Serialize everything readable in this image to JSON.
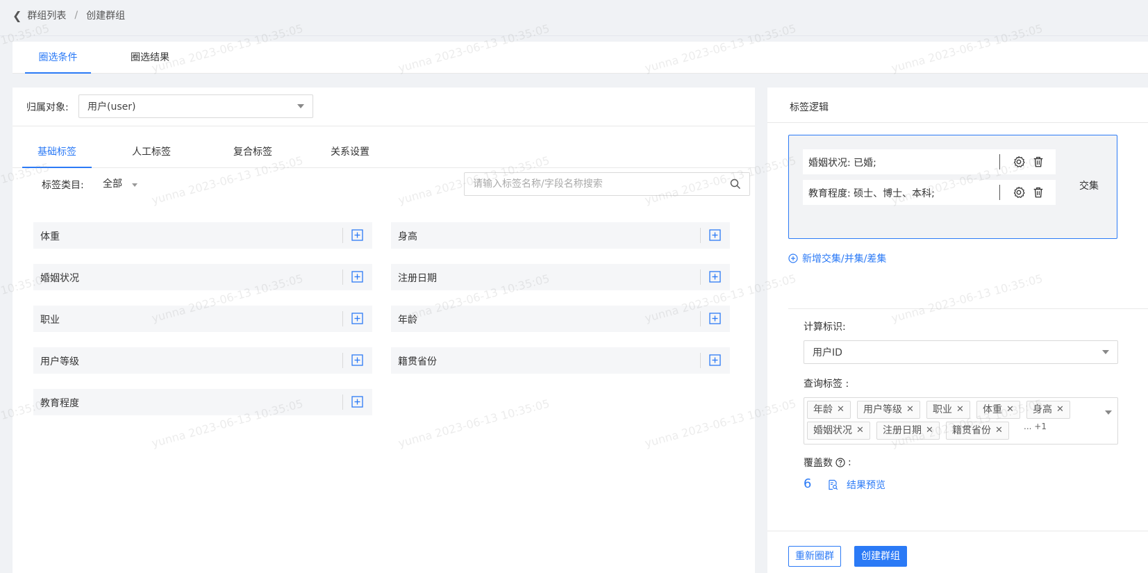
{
  "breadcrumb": {
    "parent": "群组列表",
    "separator": "/",
    "current": "创建群组"
  },
  "main_tabs": [
    {
      "label": "圈选条件",
      "active": true
    },
    {
      "label": "圈选结果",
      "active": false
    }
  ],
  "owner": {
    "label": "归属对象:",
    "value": "用户(user)"
  },
  "sub_tabs": [
    {
      "label": "基础标签",
      "active": true
    },
    {
      "label": "人工标签",
      "active": false
    },
    {
      "label": "复合标签",
      "active": false
    },
    {
      "label": "关系设置",
      "active": false
    }
  ],
  "category": {
    "label": "标签类目:",
    "value": "全部"
  },
  "search": {
    "placeholder": "请输入标签名称/字段名称搜索"
  },
  "tags": [
    "体重",
    "身高",
    "婚姻状况",
    "注册日期",
    "职业",
    "年龄",
    "用户等级",
    "籍贯省份",
    "教育程度"
  ],
  "logic": {
    "title": "标签逻辑",
    "conditions": [
      "婚姻状况:  已婚;",
      "教育程度:  硕士、博士、本科;"
    ],
    "operator": "交集",
    "add_label": "新增交集/并集/差集"
  },
  "calc": {
    "label": "计算标识:",
    "value": "用户ID"
  },
  "query": {
    "label": "查询标签 :",
    "chips_row1": [
      "年龄",
      "用户等级",
      "职业",
      "体重",
      "身高"
    ],
    "chips_row2": [
      "婚姻状况",
      "注册日期",
      "籍贯省份"
    ],
    "more": "... +1"
  },
  "cover": {
    "label": "覆盖数",
    "colon": ":",
    "value": "6",
    "preview_label": "结果预览"
  },
  "buttons": {
    "reset": "重新圈群",
    "create": "创建群组"
  },
  "watermark": {
    "text": "yunna 2023-06-13 10:35:05",
    "partial": "10:35:05"
  },
  "colors": {
    "accent": "#2b7af6"
  }
}
